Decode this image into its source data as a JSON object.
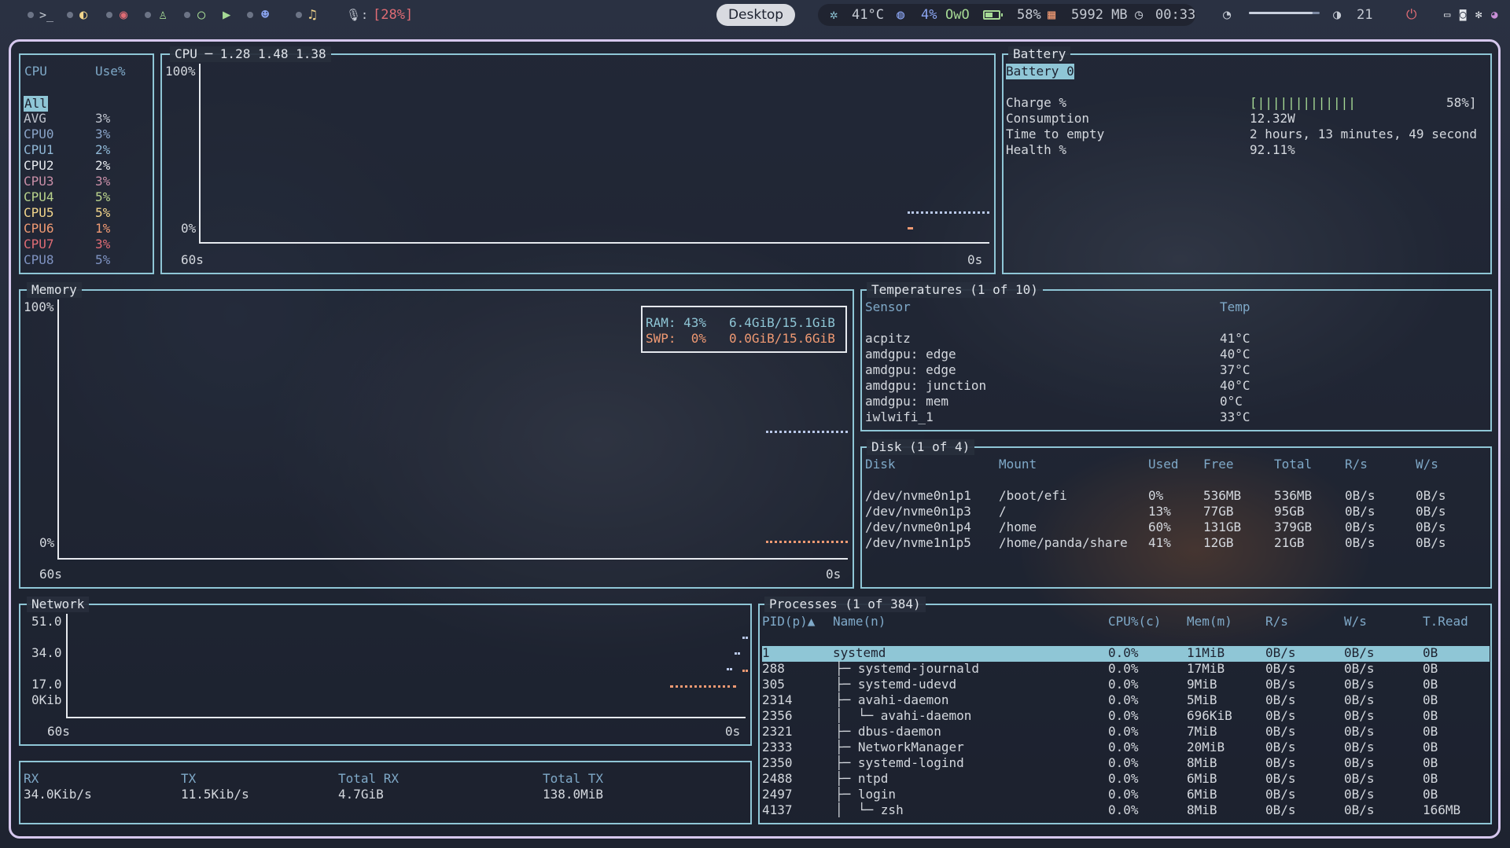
{
  "topbar": {
    "mic_level": "[28%]",
    "workspace": "Desktop",
    "cpu_temp": "41°C",
    "cpu_usage": "4%",
    "owo": "OwO",
    "battery": "58%",
    "memory": "5992 MB",
    "clock": "00:33",
    "volume_fraction": 0.9,
    "brightness": "21",
    "colors": {
      "accent": "#8fc6d6",
      "red": "#e06c75",
      "green": "#a6da95",
      "frame": "#d6c8ee"
    }
  },
  "cpu_list": {
    "header_cpu": "CPU",
    "header_use": "Use%",
    "all_label": "All",
    "rows": [
      {
        "name": "AVG",
        "use": "3%",
        "color": "#bfc4ce"
      },
      {
        "name": "CPU0",
        "use": "3%",
        "color": "#8aa4c8"
      },
      {
        "name": "CPU1",
        "use": "2%",
        "color": "#8fb7d6"
      },
      {
        "name": "CPU2",
        "use": "2%",
        "color": "#e6e9ee"
      },
      {
        "name": "CPU3",
        "use": "3%",
        "color": "#c98fa8"
      },
      {
        "name": "CPU4",
        "use": "5%",
        "color": "#b9d38c"
      },
      {
        "name": "CPU5",
        "use": "5%",
        "color": "#f3d68c"
      },
      {
        "name": "CPU6",
        "use": "1%",
        "color": "#f09a73"
      },
      {
        "name": "CPU7",
        "use": "3%",
        "color": "#e06c75"
      },
      {
        "name": "CPU8",
        "use": "5%",
        "color": "#7f93c2"
      }
    ]
  },
  "cpu_chart": {
    "title": "CPU ─ 1.28 1.48 1.38",
    "y_top": "100%",
    "y_bottom": "0%",
    "x_left": "60s",
    "x_right": "0s"
  },
  "battery": {
    "title": "Battery",
    "selected": "Battery 0",
    "rows": [
      {
        "label": "Charge %",
        "value": "[|||||||||||||",
        "extra": "58%]"
      },
      {
        "label": "Consumption",
        "value": "12.32W",
        "extra": ""
      },
      {
        "label": "Time to empty",
        "value": "2 hours, 13 minutes, 49 second",
        "extra": ""
      },
      {
        "label": "Health %",
        "value": "92.11%",
        "extra": ""
      }
    ]
  },
  "memory": {
    "title": "Memory",
    "y_top": "100%",
    "y_bottom": "0%",
    "x_left": "60s",
    "x_right": "0s",
    "ram_line": "RAM: 43%   6.4GiB/15.1GiB",
    "swp_line": "SWP:  0%   0.0GiB/15.6GiB"
  },
  "temperatures": {
    "title": "Temperatures (1 of 10)",
    "header_sensor": "Sensor",
    "header_temp": "Temp",
    "rows": [
      {
        "sensor": "acpitz",
        "temp": "41°C"
      },
      {
        "sensor": "amdgpu: edge",
        "temp": "40°C"
      },
      {
        "sensor": "amdgpu: edge",
        "temp": "37°C"
      },
      {
        "sensor": "amdgpu: junction",
        "temp": "40°C"
      },
      {
        "sensor": "amdgpu: mem",
        "temp": "0°C"
      },
      {
        "sensor": "iwlwifi_1",
        "temp": "33°C"
      }
    ]
  },
  "disk": {
    "title": "Disk (1 of 4)",
    "headers": [
      "Disk",
      "Mount",
      "Used",
      "Free",
      "Total",
      "R/s",
      "W/s"
    ],
    "rows": [
      [
        "/dev/nvme0n1p1",
        "/boot/efi",
        "0%",
        "536MB",
        "536MB",
        "0B/s",
        "0B/s"
      ],
      [
        "/dev/nvme0n1p3",
        "/",
        "13%",
        "77GB",
        "95GB",
        "0B/s",
        "0B/s"
      ],
      [
        "/dev/nvme0n1p4",
        "/home",
        "60%",
        "131GB",
        "379GB",
        "0B/s",
        "0B/s"
      ],
      [
        "/dev/nvme1n1p5",
        "/home/panda/share",
        "41%",
        "12GB",
        "21GB",
        "0B/s",
        "0B/s"
      ]
    ]
  },
  "network": {
    "title": "Network",
    "y_labels": [
      "51.0",
      "34.0",
      "17.0",
      "0Kib"
    ],
    "x_left": "60s",
    "x_right": "0s",
    "stats_headers": [
      "RX",
      "TX",
      "Total RX",
      "Total TX"
    ],
    "stats_values": [
      "34.0Kib/s",
      "11.5Kib/s",
      "4.7GiB",
      "138.0MiB"
    ]
  },
  "processes": {
    "title": "Processes (1 of 384)",
    "headers": [
      "PID(p)▲",
      "Name(n)",
      "CPU%(c)",
      "Mem(m)",
      "R/s",
      "W/s",
      "T.Read"
    ],
    "rows": [
      [
        "1",
        "systemd",
        "0.0%",
        "11MiB",
        "0B/s",
        "0B/s",
        "0B"
      ],
      [
        "288",
        "├─ systemd-journald",
        "0.0%",
        "17MiB",
        "0B/s",
        "0B/s",
        "0B"
      ],
      [
        "305",
        "├─ systemd-udevd",
        "0.0%",
        "9MiB",
        "0B/s",
        "0B/s",
        "0B"
      ],
      [
        "2314",
        "├─ avahi-daemon",
        "0.0%",
        "5MiB",
        "0B/s",
        "0B/s",
        "0B"
      ],
      [
        "2356",
        "│  └─ avahi-daemon",
        "0.0%",
        "696KiB",
        "0B/s",
        "0B/s",
        "0B"
      ],
      [
        "2321",
        "├─ dbus-daemon",
        "0.0%",
        "7MiB",
        "0B/s",
        "0B/s",
        "0B"
      ],
      [
        "2333",
        "├─ NetworkManager",
        "0.0%",
        "20MiB",
        "0B/s",
        "0B/s",
        "0B"
      ],
      [
        "2350",
        "├─ systemd-logind",
        "0.0%",
        "8MiB",
        "0B/s",
        "0B/s",
        "0B"
      ],
      [
        "2488",
        "├─ ntpd",
        "0.0%",
        "6MiB",
        "0B/s",
        "0B/s",
        "0B"
      ],
      [
        "2497",
        "├─ login",
        "0.0%",
        "6MiB",
        "0B/s",
        "0B/s",
        "0B"
      ],
      [
        "4137",
        "│  └─ zsh",
        "0.0%",
        "8MiB",
        "0B/s",
        "0B/s",
        "166MB"
      ]
    ]
  }
}
